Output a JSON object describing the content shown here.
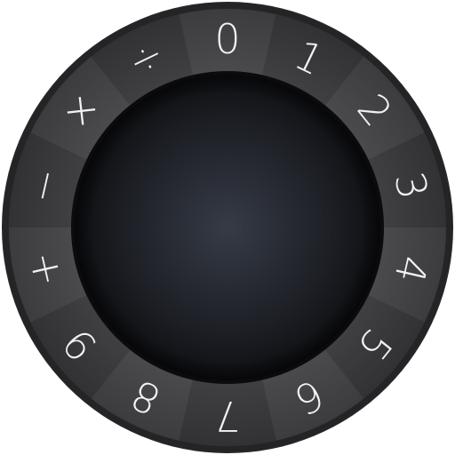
{
  "dial": {
    "keys": [
      {
        "label": "0",
        "name": "key-0"
      },
      {
        "label": "1",
        "name": "key-1"
      },
      {
        "label": "2",
        "name": "key-2"
      },
      {
        "label": "3",
        "name": "key-3"
      },
      {
        "label": "4",
        "name": "key-4"
      },
      {
        "label": "5",
        "name": "key-5"
      },
      {
        "label": "6",
        "name": "key-6"
      },
      {
        "label": "7",
        "name": "key-7"
      },
      {
        "label": "8",
        "name": "key-8"
      },
      {
        "label": "9",
        "name": "key-9"
      },
      {
        "label": "+",
        "name": "key-plus"
      },
      {
        "label": "−",
        "name": "key-minus"
      },
      {
        "label": "×",
        "name": "key-multiply"
      },
      {
        "label": "÷",
        "name": "key-divide"
      }
    ],
    "colors": {
      "ring_outer": "#2b2b2d",
      "segment_dark": "#3a3a3c",
      "segment_light": "#4a4a4c",
      "center_mid": "#353a45",
      "center_edge": "#101115",
      "label": "#f2f2f2"
    }
  }
}
